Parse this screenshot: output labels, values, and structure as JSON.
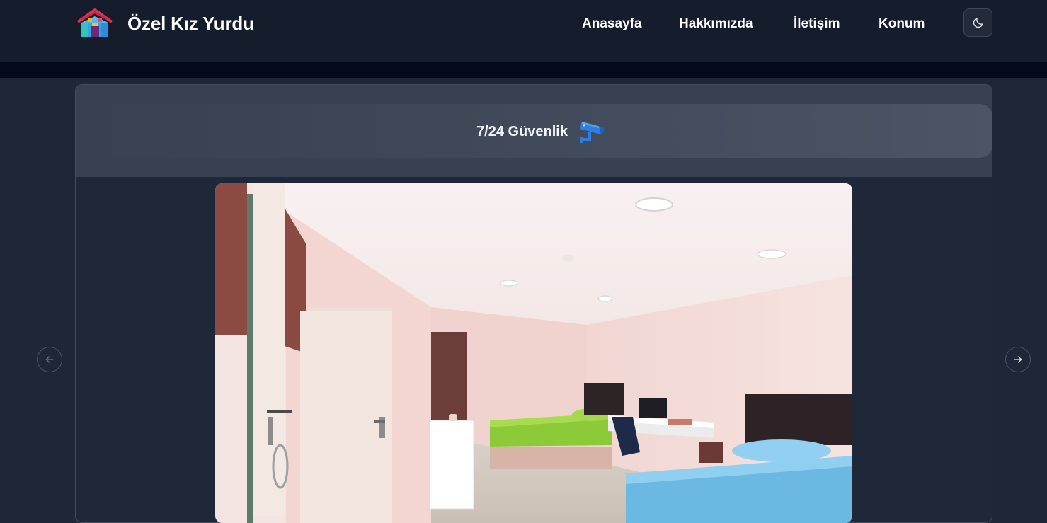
{
  "header": {
    "brand_title": "Özel Kız Yurdu",
    "nav": [
      "Anasayfa",
      "Hakkımızda",
      "İletişim",
      "Konum"
    ],
    "theme_toggle_icon": "moon-icon"
  },
  "slide": {
    "feature_label": "7/24 Güvenlik",
    "feature_icon": "security-camera-icon",
    "image_subject": "dormitory-room-photo"
  },
  "carousel": {
    "prev_icon": "arrow-left-icon",
    "next_icon": "arrow-right-icon"
  },
  "colors": {
    "navbar": "#151c2c",
    "page_background": "#1e2738",
    "card_header": "#374151",
    "accent_blue": "#2f7de1"
  }
}
